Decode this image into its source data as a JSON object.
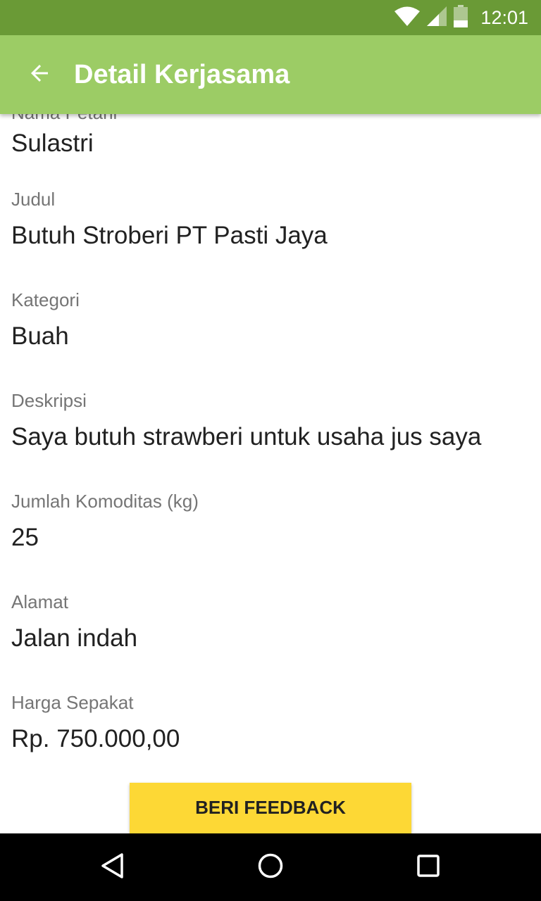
{
  "status_bar": {
    "time": "12:01",
    "icons": [
      "wifi-icon",
      "signal-icon",
      "battery-icon"
    ]
  },
  "app_bar": {
    "title": "Detail Kerjasama",
    "back_icon": "arrow-back-icon"
  },
  "fields": [
    {
      "label": "Nama Petani",
      "value": "Sulastri"
    },
    {
      "label": "Judul",
      "value": "Butuh Stroberi PT Pasti Jaya"
    },
    {
      "label": "Kategori",
      "value": "Buah"
    },
    {
      "label": "Deskripsi",
      "value": "Saya butuh strawberi untuk usaha jus saya"
    },
    {
      "label": "Jumlah Komoditas (kg)",
      "value": "25"
    },
    {
      "label": "Alamat",
      "value": "Jalan indah"
    },
    {
      "label": "Harga Sepakat",
      "value": "Rp. 750.000,00"
    }
  ],
  "feedback_button": {
    "label": "BERI FEEDBACK"
  },
  "nav_bar": {
    "buttons": [
      "back-triangle-icon",
      "home-circle-icon",
      "recents-square-icon"
    ]
  },
  "colors": {
    "status_bar": "#6a9a36",
    "app_bar": "#9ccc65",
    "button": "#fdd835",
    "label_text": "#757575",
    "value_text": "#212121"
  }
}
